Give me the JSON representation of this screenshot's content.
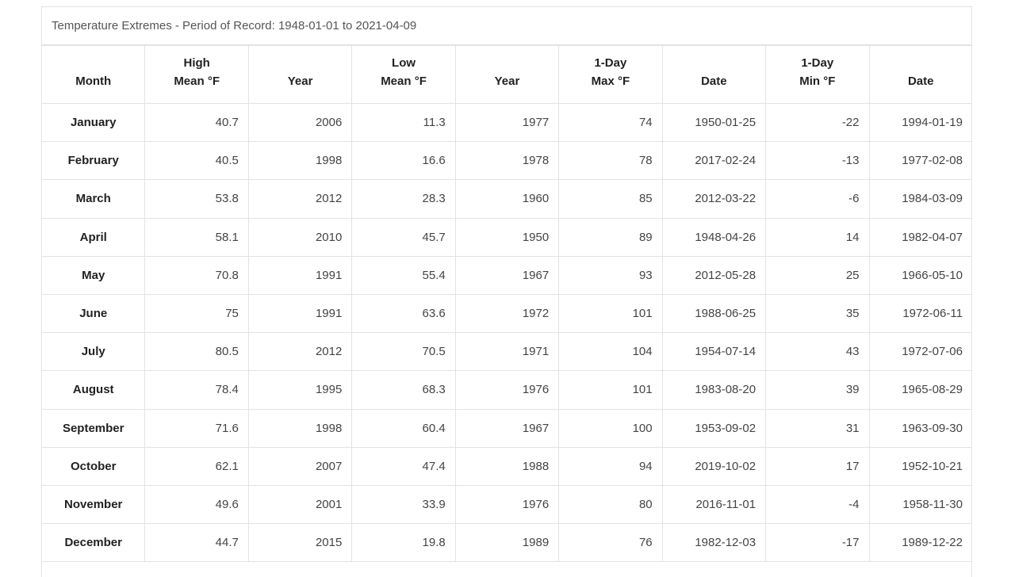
{
  "caption": "Temperature Extremes - Period of Record: 1948-01-01 to 2021-04-09",
  "headers": [
    {
      "line1": "",
      "line2": "Month"
    },
    {
      "line1": "High",
      "line2": "Mean °F"
    },
    {
      "line1": "",
      "line2": "Year"
    },
    {
      "line1": "Low",
      "line2": "Mean °F"
    },
    {
      "line1": "",
      "line2": "Year"
    },
    {
      "line1": "1-Day",
      "line2": "Max °F"
    },
    {
      "line1": "",
      "line2": "Date"
    },
    {
      "line1": "1-Day",
      "line2": "Min °F"
    },
    {
      "line1": "",
      "line2": "Date"
    }
  ],
  "rows": [
    [
      "January",
      "40.7",
      "2006",
      "11.3",
      "1977",
      "74",
      "1950-01-25",
      "-22",
      "1994-01-19"
    ],
    [
      "February",
      "40.5",
      "1998",
      "16.6",
      "1978",
      "78",
      "2017-02-24",
      "-13",
      "1977-02-08"
    ],
    [
      "March",
      "53.8",
      "2012",
      "28.3",
      "1960",
      "85",
      "2012-03-22",
      "-6",
      "1984-03-09"
    ],
    [
      "April",
      "58.1",
      "2010",
      "45.7",
      "1950",
      "89",
      "1948-04-26",
      "14",
      "1982-04-07"
    ],
    [
      "May",
      "70.8",
      "1991",
      "55.4",
      "1967",
      "93",
      "2012-05-28",
      "25",
      "1966-05-10"
    ],
    [
      "June",
      "75",
      "1991",
      "63.6",
      "1972",
      "101",
      "1988-06-25",
      "35",
      "1972-06-11"
    ],
    [
      "July",
      "80.5",
      "2012",
      "70.5",
      "1971",
      "104",
      "1954-07-14",
      "43",
      "1972-07-06"
    ],
    [
      "August",
      "78.4",
      "1995",
      "68.3",
      "1976",
      "101",
      "1983-08-20",
      "39",
      "1965-08-29"
    ],
    [
      "September",
      "71.6",
      "1998",
      "60.4",
      "1967",
      "100",
      "1953-09-02",
      "31",
      "1963-09-30"
    ],
    [
      "October",
      "62.1",
      "2007",
      "47.4",
      "1988",
      "94",
      "2019-10-02",
      "17",
      "1952-10-21"
    ],
    [
      "November",
      "49.6",
      "2001",
      "33.9",
      "1976",
      "80",
      "2016-11-01",
      "-4",
      "1958-11-30"
    ],
    [
      "December",
      "44.7",
      "2015",
      "19.8",
      "1989",
      "76",
      "1982-12-03",
      "-17",
      "1989-12-22"
    ]
  ]
}
